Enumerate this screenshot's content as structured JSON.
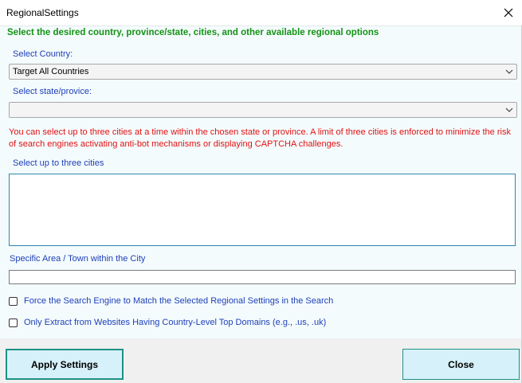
{
  "window": {
    "title": "RegionalSettings"
  },
  "heading": "Select the desired country, province/state, cities, and other available regional options",
  "country": {
    "label": "Select Country:",
    "selected": "Target All Countries"
  },
  "state": {
    "label": "Select state/provice:",
    "selected": ""
  },
  "warning": "You can select up to three cities at a time within the chosen state or province. A limit of three cities is enforced to minimize the risk of search engines activating anti-bot mechanisms or displaying CAPTCHA challenges.",
  "cities": {
    "label": "Select up to three cities",
    "items": []
  },
  "area": {
    "label": "Specific Area / Town within the City",
    "value": ""
  },
  "options": [
    {
      "label": "Force the Search Engine to Match the Selected Regional Settings in the Search",
      "checked": false
    },
    {
      "label": "Only Extract from Websites Having Country-Level Top Domains (e.g., .us, .uk)",
      "checked": false
    }
  ],
  "buttons": {
    "apply": "Apply Settings",
    "close": "Close"
  },
  "icons": {
    "close": "close-icon",
    "dropdown": "chevron-down-icon"
  }
}
